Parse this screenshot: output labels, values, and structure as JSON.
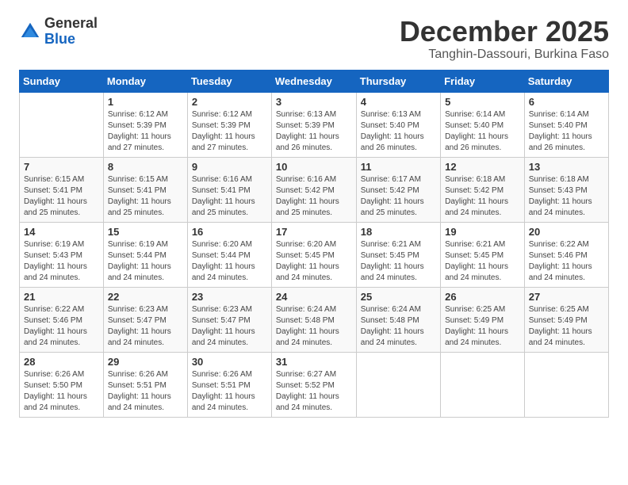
{
  "logo": {
    "general": "General",
    "blue": "Blue"
  },
  "title": "December 2025",
  "subtitle": "Tanghin-Dassouri, Burkina Faso",
  "days_of_week": [
    "Sunday",
    "Monday",
    "Tuesday",
    "Wednesday",
    "Thursday",
    "Friday",
    "Saturday"
  ],
  "weeks": [
    [
      {
        "day": "",
        "info": ""
      },
      {
        "day": "1",
        "info": "Sunrise: 6:12 AM\nSunset: 5:39 PM\nDaylight: 11 hours and 27 minutes."
      },
      {
        "day": "2",
        "info": "Sunrise: 6:12 AM\nSunset: 5:39 PM\nDaylight: 11 hours and 27 minutes."
      },
      {
        "day": "3",
        "info": "Sunrise: 6:13 AM\nSunset: 5:39 PM\nDaylight: 11 hours and 26 minutes."
      },
      {
        "day": "4",
        "info": "Sunrise: 6:13 AM\nSunset: 5:40 PM\nDaylight: 11 hours and 26 minutes."
      },
      {
        "day": "5",
        "info": "Sunrise: 6:14 AM\nSunset: 5:40 PM\nDaylight: 11 hours and 26 minutes."
      },
      {
        "day": "6",
        "info": "Sunrise: 6:14 AM\nSunset: 5:40 PM\nDaylight: 11 hours and 26 minutes."
      }
    ],
    [
      {
        "day": "7",
        "info": "Sunrise: 6:15 AM\nSunset: 5:41 PM\nDaylight: 11 hours and 25 minutes."
      },
      {
        "day": "8",
        "info": "Sunrise: 6:15 AM\nSunset: 5:41 PM\nDaylight: 11 hours and 25 minutes."
      },
      {
        "day": "9",
        "info": "Sunrise: 6:16 AM\nSunset: 5:41 PM\nDaylight: 11 hours and 25 minutes."
      },
      {
        "day": "10",
        "info": "Sunrise: 6:16 AM\nSunset: 5:42 PM\nDaylight: 11 hours and 25 minutes."
      },
      {
        "day": "11",
        "info": "Sunrise: 6:17 AM\nSunset: 5:42 PM\nDaylight: 11 hours and 25 minutes."
      },
      {
        "day": "12",
        "info": "Sunrise: 6:18 AM\nSunset: 5:42 PM\nDaylight: 11 hours and 24 minutes."
      },
      {
        "day": "13",
        "info": "Sunrise: 6:18 AM\nSunset: 5:43 PM\nDaylight: 11 hours and 24 minutes."
      }
    ],
    [
      {
        "day": "14",
        "info": "Sunrise: 6:19 AM\nSunset: 5:43 PM\nDaylight: 11 hours and 24 minutes."
      },
      {
        "day": "15",
        "info": "Sunrise: 6:19 AM\nSunset: 5:44 PM\nDaylight: 11 hours and 24 minutes."
      },
      {
        "day": "16",
        "info": "Sunrise: 6:20 AM\nSunset: 5:44 PM\nDaylight: 11 hours and 24 minutes."
      },
      {
        "day": "17",
        "info": "Sunrise: 6:20 AM\nSunset: 5:45 PM\nDaylight: 11 hours and 24 minutes."
      },
      {
        "day": "18",
        "info": "Sunrise: 6:21 AM\nSunset: 5:45 PM\nDaylight: 11 hours and 24 minutes."
      },
      {
        "day": "19",
        "info": "Sunrise: 6:21 AM\nSunset: 5:45 PM\nDaylight: 11 hours and 24 minutes."
      },
      {
        "day": "20",
        "info": "Sunrise: 6:22 AM\nSunset: 5:46 PM\nDaylight: 11 hours and 24 minutes."
      }
    ],
    [
      {
        "day": "21",
        "info": "Sunrise: 6:22 AM\nSunset: 5:46 PM\nDaylight: 11 hours and 24 minutes."
      },
      {
        "day": "22",
        "info": "Sunrise: 6:23 AM\nSunset: 5:47 PM\nDaylight: 11 hours and 24 minutes."
      },
      {
        "day": "23",
        "info": "Sunrise: 6:23 AM\nSunset: 5:47 PM\nDaylight: 11 hours and 24 minutes."
      },
      {
        "day": "24",
        "info": "Sunrise: 6:24 AM\nSunset: 5:48 PM\nDaylight: 11 hours and 24 minutes."
      },
      {
        "day": "25",
        "info": "Sunrise: 6:24 AM\nSunset: 5:48 PM\nDaylight: 11 hours and 24 minutes."
      },
      {
        "day": "26",
        "info": "Sunrise: 6:25 AM\nSunset: 5:49 PM\nDaylight: 11 hours and 24 minutes."
      },
      {
        "day": "27",
        "info": "Sunrise: 6:25 AM\nSunset: 5:49 PM\nDaylight: 11 hours and 24 minutes."
      }
    ],
    [
      {
        "day": "28",
        "info": "Sunrise: 6:26 AM\nSunset: 5:50 PM\nDaylight: 11 hours and 24 minutes."
      },
      {
        "day": "29",
        "info": "Sunrise: 6:26 AM\nSunset: 5:51 PM\nDaylight: 11 hours and 24 minutes."
      },
      {
        "day": "30",
        "info": "Sunrise: 6:26 AM\nSunset: 5:51 PM\nDaylight: 11 hours and 24 minutes."
      },
      {
        "day": "31",
        "info": "Sunrise: 6:27 AM\nSunset: 5:52 PM\nDaylight: 11 hours and 24 minutes."
      },
      {
        "day": "",
        "info": ""
      },
      {
        "day": "",
        "info": ""
      },
      {
        "day": "",
        "info": ""
      }
    ]
  ]
}
